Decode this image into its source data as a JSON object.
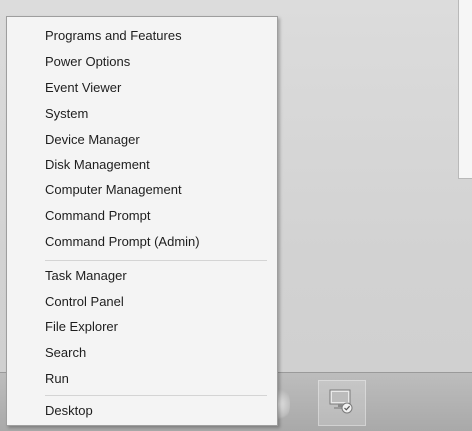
{
  "context_menu": {
    "items": [
      {
        "label": "Programs and Features"
      },
      {
        "label": "Power Options"
      },
      {
        "label": "Event Viewer"
      },
      {
        "label": "System"
      },
      {
        "label": "Device Manager"
      },
      {
        "label": "Disk Management"
      },
      {
        "label": "Computer Management"
      },
      {
        "label": "Command Prompt"
      },
      {
        "label": "Command Prompt (Admin)"
      },
      {
        "label": "Task Manager"
      },
      {
        "label": "Control Panel"
      },
      {
        "label": "File Explorer"
      },
      {
        "label": "Search"
      },
      {
        "label": "Run"
      },
      {
        "label": "Desktop"
      }
    ]
  },
  "taskbar": {
    "pinned_icon": "computer-icon"
  },
  "colors": {
    "menu_background": "#f4f4f4",
    "menu_border": "#9e9e9e",
    "text": "#1e1e1e",
    "taskbar": "#b0b0b0"
  }
}
